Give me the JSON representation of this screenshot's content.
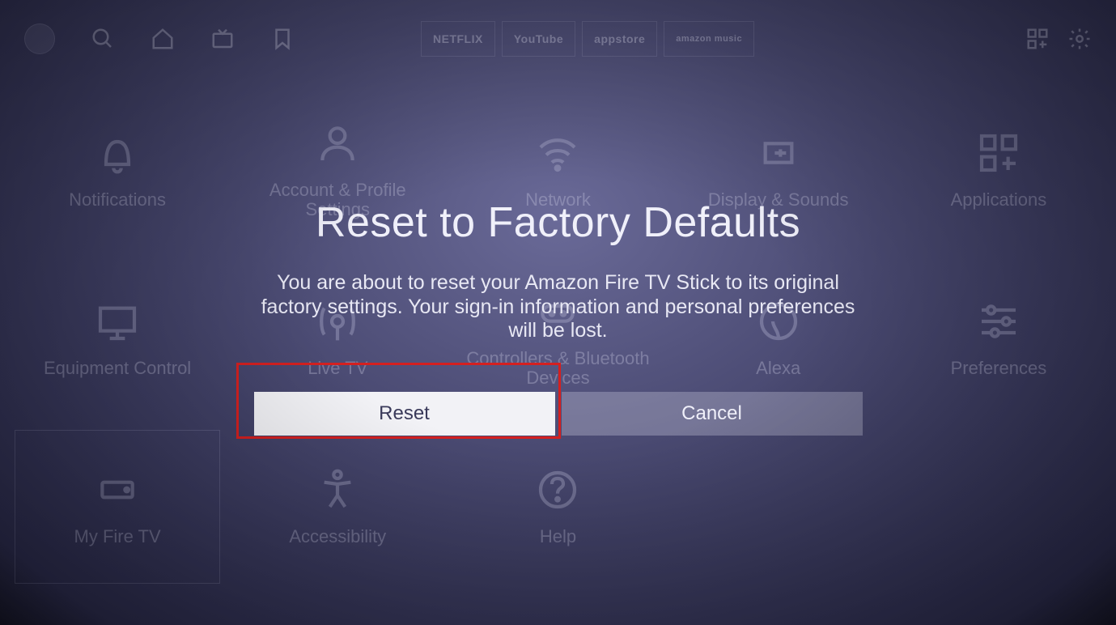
{
  "topnav": {
    "apps": [
      "NETFLIX",
      "YouTube",
      "appstore",
      "amazon music"
    ]
  },
  "settings": {
    "tiles": [
      {
        "label": "Notifications",
        "icon": "bell"
      },
      {
        "label": "Account & Profile Settings",
        "icon": "user"
      },
      {
        "label": "Network",
        "icon": "wifi"
      },
      {
        "label": "Display & Sounds",
        "icon": "volume"
      },
      {
        "label": "Applications",
        "icon": "apps"
      },
      {
        "label": "Equipment Control",
        "icon": "monitor"
      },
      {
        "label": "Live TV",
        "icon": "antenna"
      },
      {
        "label": "Controllers & Bluetooth Devices",
        "icon": "controller"
      },
      {
        "label": "Alexa",
        "icon": "alexa"
      },
      {
        "label": "Preferences",
        "icon": "sliders"
      },
      {
        "label": "My Fire TV",
        "icon": "device",
        "selected": true
      },
      {
        "label": "Accessibility",
        "icon": "accessibility"
      },
      {
        "label": "Help",
        "icon": "help"
      }
    ]
  },
  "modal": {
    "title": "Reset to Factory Defaults",
    "body": "You are about to reset your Amazon Fire TV Stick to its original factory settings. Your sign-in information and personal preferences will be lost.",
    "reset_label": "Reset",
    "cancel_label": "Cancel"
  }
}
